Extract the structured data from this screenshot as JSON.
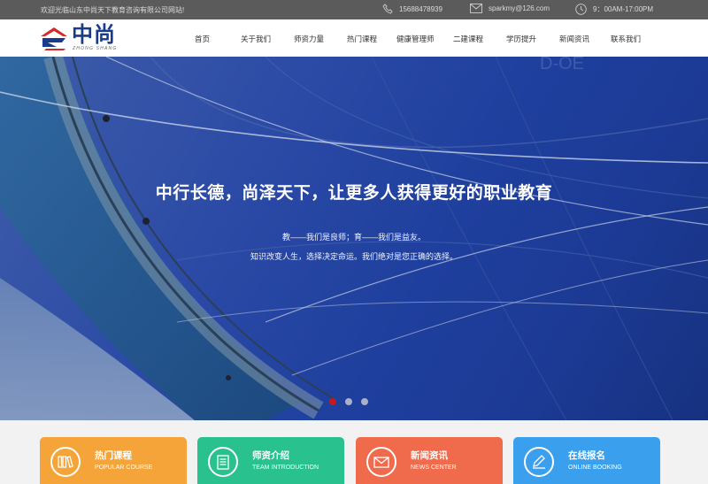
{
  "topbar": {
    "welcome": "欢迎光临山东中尚天下教育咨询有限公司网站!",
    "phone": "15688478939",
    "email": "sparkmy@126.com",
    "hours": "9：00AM-17:00PM"
  },
  "logo": {
    "text": "中尚",
    "sub": "ZHONG SHANG"
  },
  "nav": [
    {
      "label": "首页"
    },
    {
      "label": "关于我们"
    },
    {
      "label": "师资力量"
    },
    {
      "label": "热门课程"
    },
    {
      "label": "健康管理师"
    },
    {
      "label": "二建课程"
    },
    {
      "label": "学历提升"
    },
    {
      "label": "新闻资讯"
    },
    {
      "label": "联系我们"
    }
  ],
  "banner": {
    "title": "中行长德，尚泽天下，让更多人获得更好的职业教育",
    "line1": "教——我们是良师；育——我们是益友。",
    "line2": "知识改变人生，选择决定命运。我们绝对是您正确的选择。",
    "active_slide": 1,
    "slides": 3
  },
  "cards": [
    {
      "title": "热门课程",
      "sub": "POPULAR COURSE",
      "icon": "books-icon",
      "color": "#f5a43a"
    },
    {
      "title": "师资介绍",
      "sub": "TEAM INTRODUCTION",
      "icon": "document-icon",
      "color": "#29c18d"
    },
    {
      "title": "新闻资讯",
      "sub": "NEWS CENTER",
      "icon": "envelope-icon",
      "color": "#f06a4c"
    },
    {
      "title": "在线报名",
      "sub": "ONLINE BOOKING",
      "icon": "edit-icon",
      "color": "#3aa0ee"
    }
  ],
  "colors": {
    "topbar": "#5b5b5b",
    "logo_blue": "#1a3a8a",
    "logo_red": "#d42a2a",
    "banner_blue": "#2b4aa6",
    "dot_active": "#c41a1a"
  }
}
